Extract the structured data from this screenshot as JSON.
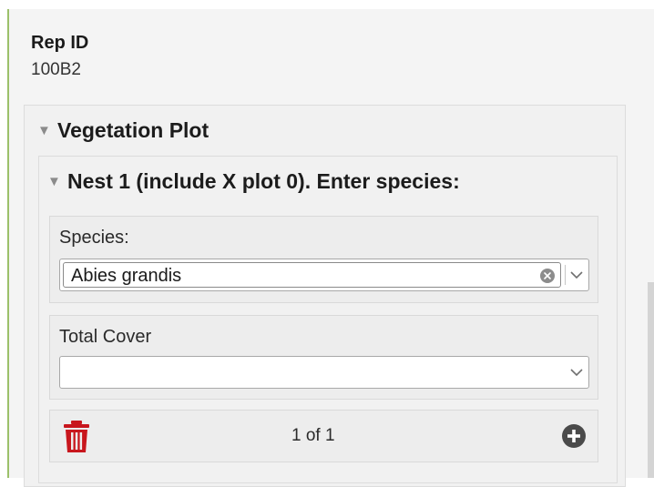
{
  "rep_id": {
    "label": "Rep ID",
    "value": "100B2"
  },
  "vegetation_plot": {
    "title": "Vegetation Plot",
    "expanded": true,
    "nest": {
      "title": "Nest 1 (include X plot 0). Enter species:",
      "expanded": true,
      "species": {
        "label": "Species:",
        "value": "Abies grandis"
      },
      "total_cover": {
        "label": "Total Cover",
        "value": ""
      },
      "footer": {
        "counter": "1 of 1"
      }
    }
  },
  "colors": {
    "accent_rule": "#9cc06a",
    "delete_red": "#c8161d",
    "add_dark": "#4a4a4a"
  },
  "icons": {
    "collapse": "triangle-down-icon",
    "clear": "clear-circle-icon",
    "dropdown": "chevron-down-icon",
    "delete": "trash-icon",
    "add": "plus-circle-icon"
  }
}
